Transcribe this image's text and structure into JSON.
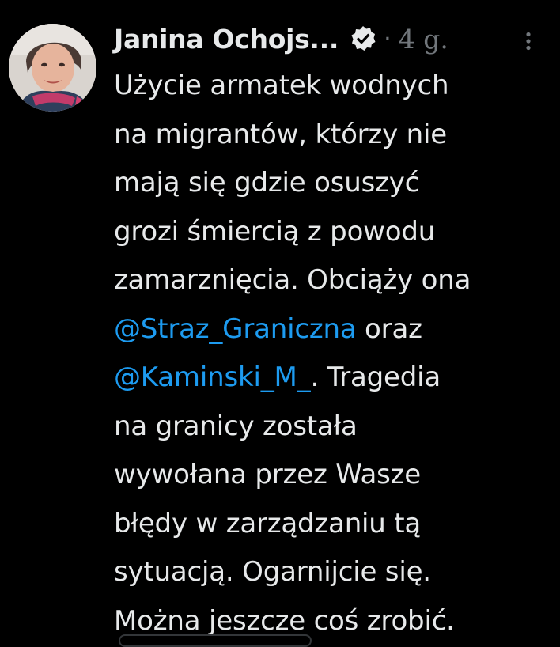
{
  "tweet": {
    "author": {
      "display_name": "Janina Ochojs...",
      "verified": true,
      "avatar_icon": "avatar-photo"
    },
    "separator": "·",
    "timestamp": "4 g.",
    "more_icon": "more-vertical-icon",
    "verified_icon": "verified-badge-icon",
    "text_lines": {
      "l1": "Użycie armatek wodnych",
      "l2": "na migrantów, którzy nie",
      "l3": "mają się gdzie osuszyć",
      "l4": "grozi śmiercią z powodu",
      "l5": "zamarznięcia. Obciąży ona",
      "l6_mention": "@Straz_Graniczna",
      "l6_rest": " oraz",
      "l7_mention": "@Kaminski_M_",
      "l7_rest": ". Tragedia",
      "l8": "na granicy została",
      "l9": "wywołana przez Wasze",
      "l10": "błędy w zarządzaniu tą",
      "l11": "sytuacją. Ogarnijcie się.",
      "l12": "Można jeszcze coś zrobić."
    },
    "colors": {
      "background": "#000000",
      "text": "#e7e9ea",
      "secondary": "#71767b",
      "mention": "#1d9bf0"
    }
  }
}
